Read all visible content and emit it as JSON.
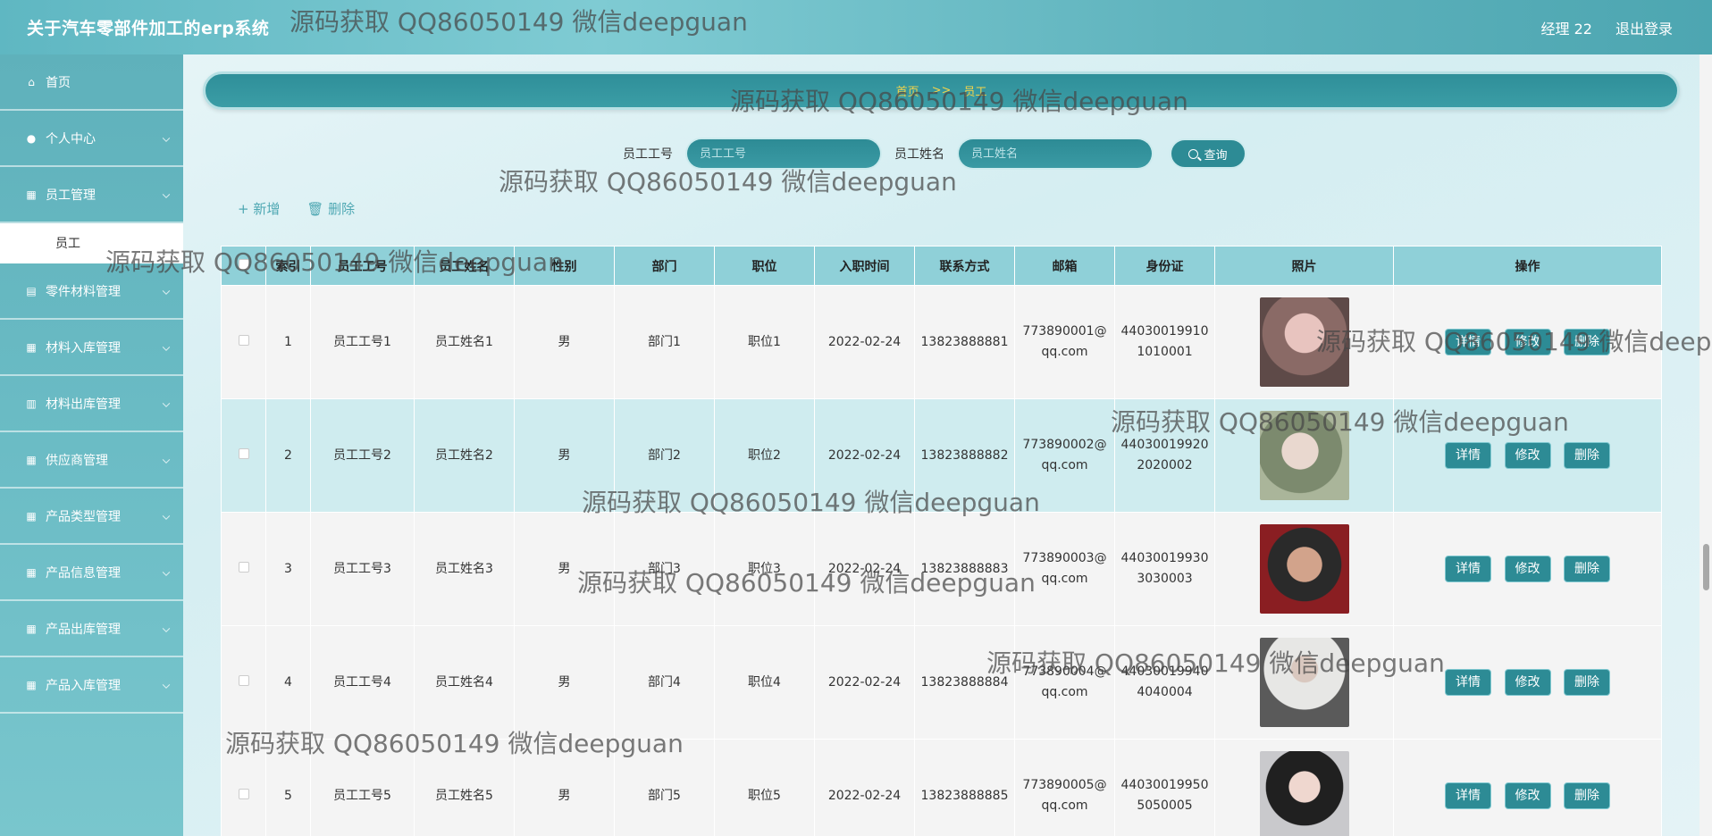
{
  "header": {
    "app_title": "关于汽车零部件加工的erp系统",
    "user_label": "经理 22",
    "logout_label": "退出登录"
  },
  "sidebar": {
    "items": [
      {
        "label": "首页",
        "icon": "home-icon"
      },
      {
        "label": "个人中心",
        "icon": "user-icon"
      },
      {
        "label": "员工管理",
        "icon": "grid-icon"
      },
      {
        "label": "零件材料管理",
        "icon": "clipboard-icon"
      },
      {
        "label": "材料入库管理",
        "icon": "grid-icon"
      },
      {
        "label": "材料出库管理",
        "icon": "chart-icon"
      },
      {
        "label": "供应商管理",
        "icon": "grid-icon"
      },
      {
        "label": "产品类型管理",
        "icon": "grid-icon"
      },
      {
        "label": "产品信息管理",
        "icon": "grid-icon"
      },
      {
        "label": "产品出库管理",
        "icon": "grid-icon"
      },
      {
        "label": "产品入库管理",
        "icon": "grid-icon"
      }
    ],
    "active_sub": "员工"
  },
  "breadcrumb": {
    "home": "首页",
    "separator": ">>",
    "current": "员工"
  },
  "search": {
    "field1_label": "员工工号",
    "field1_placeholder": "员工工号",
    "field2_label": "员工姓名",
    "field2_placeholder": "员工姓名",
    "button_label": "查询"
  },
  "actions": {
    "add_label": "新增",
    "delete_label": "删除"
  },
  "table": {
    "columns": [
      "",
      "索引",
      "员工工号",
      "员工姓名",
      "性别",
      "部门",
      "职位",
      "入职时间",
      "联系方式",
      "邮箱",
      "身份证",
      "照片",
      "操作"
    ],
    "rows": [
      {
        "index": "1",
        "emp_no": "员工工号1",
        "name": "员工姓名1",
        "gender": "男",
        "dept": "部门1",
        "position": "职位1",
        "date": "2022-02-24",
        "phone": "13823888881",
        "email1": "773890001@",
        "email2": "qq.com",
        "id1": "44030019910",
        "id2": "1010001"
      },
      {
        "index": "2",
        "emp_no": "员工工号2",
        "name": "员工姓名2",
        "gender": "男",
        "dept": "部门2",
        "position": "职位2",
        "date": "2022-02-24",
        "phone": "13823888882",
        "email1": "773890002@",
        "email2": "qq.com",
        "id1": "44030019920",
        "id2": "2020002"
      },
      {
        "index": "3",
        "emp_no": "员工工号3",
        "name": "员工姓名3",
        "gender": "男",
        "dept": "部门3",
        "position": "职位3",
        "date": "2022-02-24",
        "phone": "13823888883",
        "email1": "773890003@",
        "email2": "qq.com",
        "id1": "44030019930",
        "id2": "3030003"
      },
      {
        "index": "4",
        "emp_no": "员工工号4",
        "name": "员工姓名4",
        "gender": "男",
        "dept": "部门4",
        "position": "职位4",
        "date": "2022-02-24",
        "phone": "13823888884",
        "email1": "773890004@",
        "email2": "qq.com",
        "id1": "44030019940",
        "id2": "4040004"
      },
      {
        "index": "5",
        "emp_no": "员工工号5",
        "name": "员工姓名5",
        "gender": "男",
        "dept": "部门5",
        "position": "职位5",
        "date": "2022-02-24",
        "phone": "13823888885",
        "email1": "773890005@",
        "email2": "qq.com",
        "id1": "44030019950",
        "id2": "5050005"
      }
    ],
    "op_detail": "详情",
    "op_edit": "修改",
    "op_delete": "删除"
  },
  "watermark_text": "源码获取 QQ86050149 微信deepguan",
  "colors": {
    "accent": "#2d8b95",
    "header_bg": "#5fb7c2",
    "table_header": "#8fd0d8",
    "row_teal": "#cfecef",
    "breadcrumb_text": "#f2d34a"
  }
}
